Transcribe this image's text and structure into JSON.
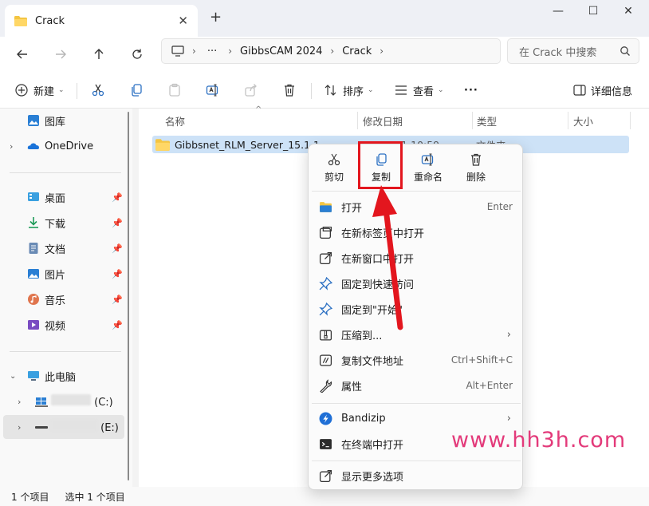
{
  "window": {
    "tab_title": "Crack",
    "tab_close": "✕",
    "new_tab": "+",
    "minimize": "—",
    "maximize": "☐",
    "close": "✕"
  },
  "address": {
    "path": [
      "GibbsCAM 2024",
      "Crack"
    ],
    "overflow": "···",
    "search_placeholder": "在 Crack 中搜索"
  },
  "toolbar": {
    "new_label": "新建",
    "sort_label": "排序",
    "view_label": "查看",
    "more_label": "···",
    "details_label": "详细信息"
  },
  "sidebar": {
    "gallery": "图库",
    "onedrive": "OneDrive",
    "desktop": "桌面",
    "downloads": "下载",
    "documents": "文档",
    "pictures": "图片",
    "music": "音乐",
    "videos": "视频",
    "thispc": "此电脑",
    "drive_c": "(C:)",
    "drive_e": "(E:)"
  },
  "columns": {
    "name": "名称",
    "date": "修改日期",
    "type": "类型",
    "size": "大小"
  },
  "file": {
    "name": "Gibbsnet_RLM_Server_15.1.1",
    "date": "2024/1/1 10:59",
    "type": "文件夹"
  },
  "status": {
    "count": "1 个项目",
    "selected": "选中 1 个项目"
  },
  "context_menu": {
    "top": {
      "cut": "剪切",
      "copy": "复制",
      "rename": "重命名",
      "delete": "删除"
    },
    "items": [
      {
        "label": "打开",
        "shortcut": "Enter"
      },
      {
        "label": "在新标签页中打开",
        "shortcut": ""
      },
      {
        "label": "在新窗口中打开",
        "shortcut": ""
      },
      {
        "label": "固定到快速访问",
        "shortcut": ""
      },
      {
        "label": "固定到\"开始\"",
        "shortcut": ""
      },
      {
        "label": "压缩到...",
        "shortcut": "›"
      },
      {
        "label": "复制文件地址",
        "shortcut": "Ctrl+Shift+C"
      },
      {
        "label": "属性",
        "shortcut": "Alt+Enter"
      },
      {
        "label": "Bandizip",
        "shortcut": "›"
      },
      {
        "label": "在终端中打开",
        "shortcut": ""
      },
      {
        "label": "显示更多选项",
        "shortcut": ""
      }
    ]
  },
  "watermark": "www.hh3h.com",
  "colors": {
    "highlight_box": "#e3161e",
    "selection": "#cde2f7",
    "watermark": "#e33a7a"
  }
}
